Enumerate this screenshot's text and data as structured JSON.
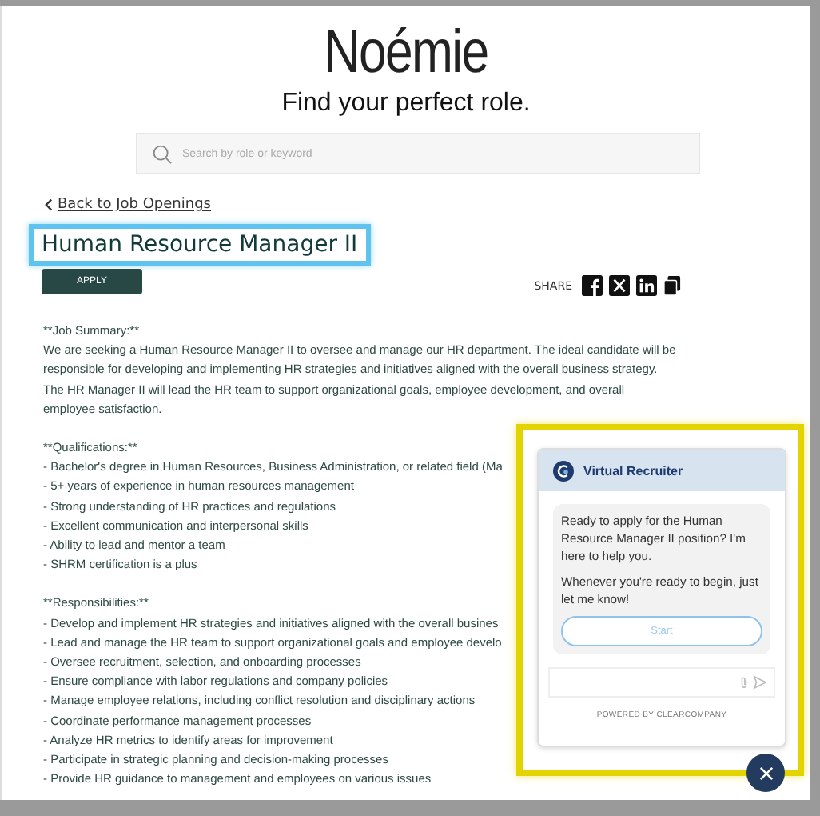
{
  "brand": {
    "logo": "Noémie",
    "tagline": "Find your perfect role."
  },
  "search": {
    "placeholder": "Search by role or keyword"
  },
  "back_link": "Back to Job Openings",
  "job": {
    "title": "Human Resource Manager II",
    "apply": "APPLY",
    "share_label": "SHARE"
  },
  "description": {
    "summary_heading": "**Job Summary:**",
    "summary": "We are seeking a Human Resource Manager II to oversee and manage our HR department. The ideal candidate will be responsible for developing and implementing HR strategies and initiatives aligned with the overall business strategy. The HR Manager II will lead the HR team to support organizational goals, employee development, and overall employee satisfaction.",
    "sections": [
      {
        "heading": "**Qualifications:**",
        "items": [
          "- Bachelor's degree in Human Resources, Business Administration, or related field (Ma",
          "- 5+ years of experience in human resources management",
          "- Strong understanding of HR practices and regulations",
          "- Excellent communication and interpersonal skills",
          "- Ability to lead and mentor a team",
          "- SHRM certification is a plus"
        ]
      },
      {
        "heading": "**Responsibilities:**",
        "items": [
          "- Develop and implement HR strategies and initiatives aligned with the overall busines",
          "- Lead and manage the HR team to support organizational goals and employee develo",
          "- Oversee recruitment, selection, and onboarding processes",
          "- Ensure compliance with labor regulations and company policies",
          "- Manage employee relations, including conflict resolution and disciplinary actions",
          "- Coordinate performance management processes",
          "- Analyze HR metrics to identify areas for improvement",
          "- Participate in strategic planning and decision-making processes",
          "- Provide HR guidance to management and employees on various issues"
        ]
      }
    ]
  },
  "chat": {
    "title": "Virtual Recruiter",
    "messages": [
      "Ready to apply for the Human Resource Manager II position? I'm here to help you.",
      "Whenever you're ready to begin, just let me know!"
    ],
    "start_button": "Start",
    "footer": "POWERED BY CLEARCOMPANY"
  }
}
